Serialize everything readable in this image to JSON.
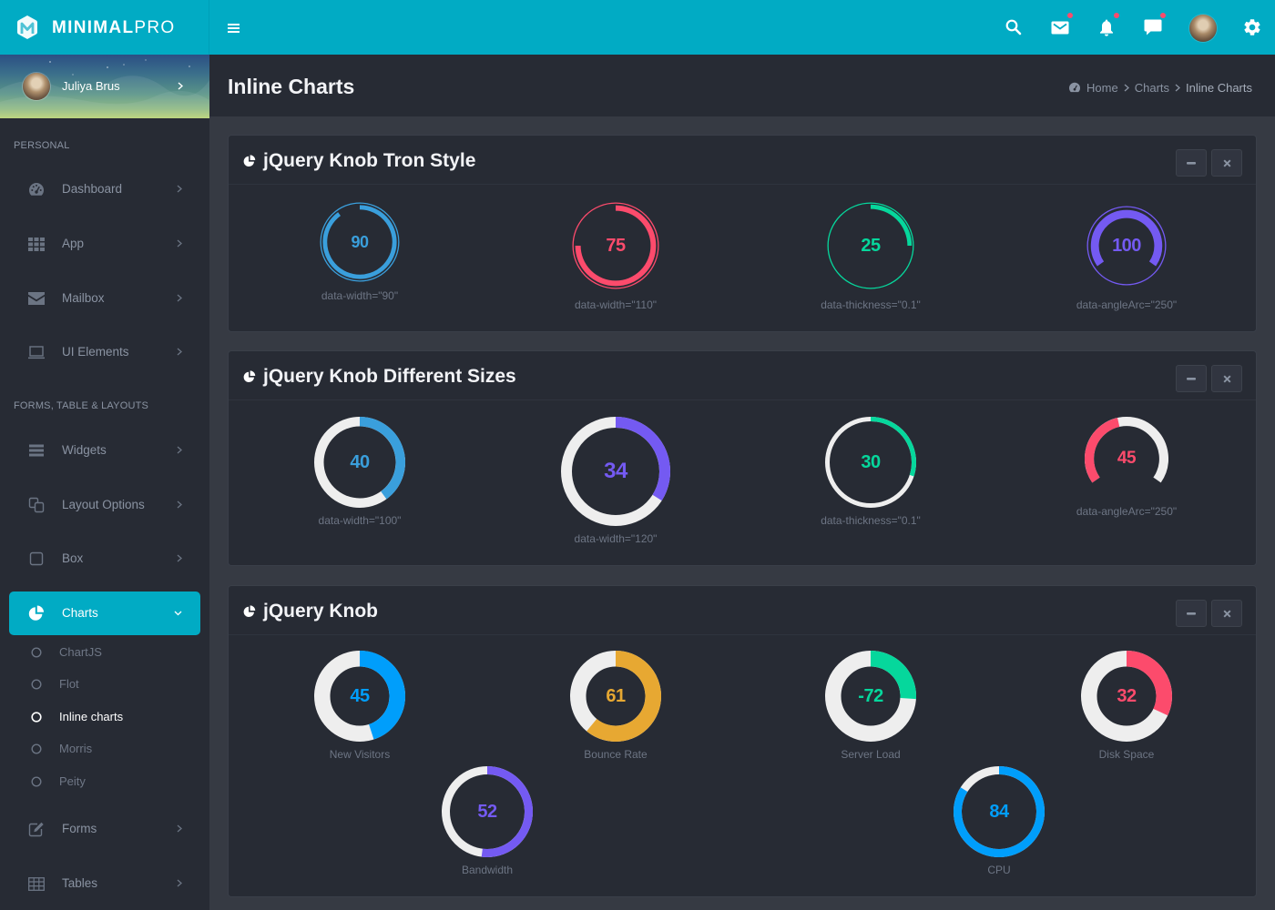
{
  "theme": {
    "accent": "#01abc4",
    "badge": "#fc4b6c",
    "knob_track": "#eeeeee"
  },
  "header": {
    "brand": {
      "bold": "MINIMAL",
      "light": "PRO"
    },
    "icons": {
      "menu": "menu-icon",
      "search": "search-icon",
      "mail": "mail-icon",
      "notifications": "bell-icon",
      "messages": "chat-icon",
      "profile": "user-avatar",
      "settings": "gear-icon"
    },
    "badges": {
      "mail": true,
      "notifications": true,
      "messages": true
    }
  },
  "sidebar": {
    "user": {
      "name": "Juliya Brus"
    },
    "sections": [
      {
        "title": "PERSONAL",
        "items": [
          {
            "label": "Dashboard",
            "icon": "dashboard-icon"
          },
          {
            "label": "App",
            "icon": "apps-icon"
          },
          {
            "label": "Mailbox",
            "icon": "mail-icon"
          },
          {
            "label": "UI Elements",
            "icon": "laptop-icon"
          }
        ]
      },
      {
        "title": "FORMS, TABLE & LAYOUTS",
        "items": [
          {
            "label": "Widgets",
            "icon": "widgets-icon"
          },
          {
            "label": "Layout Options",
            "icon": "copy-icon"
          },
          {
            "label": "Box",
            "icon": "square-icon"
          },
          {
            "label": "Charts",
            "icon": "pie-chart-icon",
            "active": true,
            "expanded": true,
            "submenu": [
              {
                "label": "ChartJS"
              },
              {
                "label": "Flot"
              },
              {
                "label": "Inline charts",
                "active": true
              },
              {
                "label": "Morris"
              },
              {
                "label": "Peity"
              }
            ]
          },
          {
            "label": "Forms",
            "icon": "edit-icon"
          },
          {
            "label": "Tables",
            "icon": "table-icon"
          }
        ]
      }
    ]
  },
  "page": {
    "title": "Inline Charts",
    "breadcrumb": [
      {
        "label": "Home",
        "icon": "dashboard-icon"
      },
      {
        "label": "Charts"
      },
      {
        "label": "Inline Charts"
      }
    ]
  },
  "chart_data": [
    {
      "type": "pie",
      "variant": "knob-tron",
      "title": "jQuery Knob Tron Style",
      "knobs": [
        {
          "value": 90,
          "min": 0,
          "max": 100,
          "color": "#3a9fdc",
          "label": "data-width=\"90\""
        },
        {
          "value": 75,
          "min": 0,
          "max": 100,
          "color": "#fc4b6c",
          "label": "data-width=\"110\""
        },
        {
          "value": 25,
          "min": 0,
          "max": 100,
          "color": "#06d79c",
          "label": "data-thickness=\"0.1\""
        },
        {
          "value": 100,
          "min": 0,
          "max": 100,
          "color": "#745af2",
          "label": "data-angleArc=\"250\""
        }
      ]
    },
    {
      "type": "pie",
      "variant": "knob",
      "title": "jQuery Knob Different Sizes",
      "knobs": [
        {
          "value": 40,
          "min": 0,
          "max": 100,
          "color": "#3a9fdc",
          "label": "data-width=\"100\""
        },
        {
          "value": 34,
          "min": 0,
          "max": 100,
          "color": "#745af2",
          "label": "data-width=\"120\""
        },
        {
          "value": 30,
          "min": 0,
          "max": 100,
          "color": "#06d79c",
          "label": "data-thickness=\"0.1\""
        },
        {
          "value": 45,
          "min": 0,
          "max": 100,
          "color": "#fc4b6c",
          "label": "data-angleArc=\"250\""
        }
      ]
    },
    {
      "type": "pie",
      "variant": "knob",
      "title": "jQuery Knob",
      "knobs": [
        {
          "value": 45,
          "min": 0,
          "max": 100,
          "color": "#009efb",
          "label": "New Visitors"
        },
        {
          "value": 61,
          "min": 0,
          "max": 100,
          "color": "#e7a832",
          "label": "Bounce Rate"
        },
        {
          "value": -72,
          "min": -150,
          "max": 150,
          "color": "#06d79c",
          "label": "Server Load"
        },
        {
          "value": 32,
          "min": 0,
          "max": 100,
          "color": "#fc4b6c",
          "label": "Disk Space"
        },
        {
          "value": 52,
          "min": 0,
          "max": 100,
          "color": "#745af2",
          "label": "Bandwidth"
        },
        {
          "value": 84,
          "min": 0,
          "max": 100,
          "color": "#009efb",
          "label": "CPU"
        }
      ]
    }
  ]
}
